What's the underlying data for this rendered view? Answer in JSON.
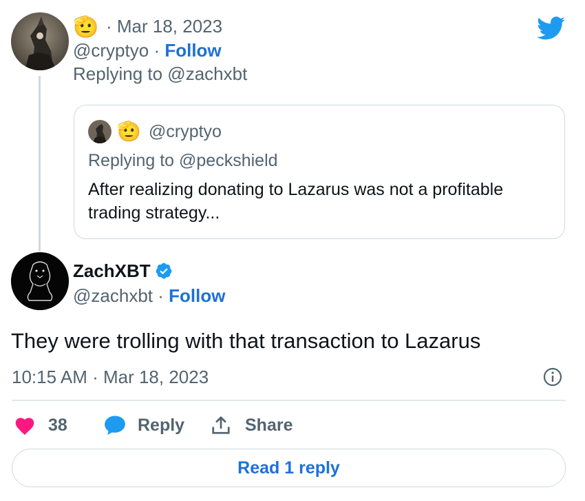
{
  "parent_tweet": {
    "emoji": "🫡",
    "date": "· Mar 18, 2023",
    "handle": "@cryptyo",
    "separator": "·",
    "follow_label": "Follow",
    "replying_to": "Replying to @zachxbt"
  },
  "quoted_tweet": {
    "emoji": "🫡",
    "handle": "@cryptyo",
    "replying_to": "Replying to @peckshield",
    "text_line1": "After realizing donating to Lazarus was not a profitable",
    "text_line2": "trading strategy..."
  },
  "main_tweet": {
    "display_name": "ZachXBT",
    "handle": "@zachxbt",
    "separator": "·",
    "follow_label": "Follow",
    "text": "They were trolling with that transaction to Lazarus",
    "timestamp": "10:15 AM · Mar 18, 2023"
  },
  "actions": {
    "like_count": "38",
    "reply_label": "Reply",
    "share_label": "Share"
  },
  "read_replies_label": "Read 1 reply",
  "colors": {
    "twitter_blue": "#1d9bf0",
    "link_blue": "#1d70d8",
    "like_pink": "#f91880",
    "verified_blue": "#1d9bf0"
  }
}
